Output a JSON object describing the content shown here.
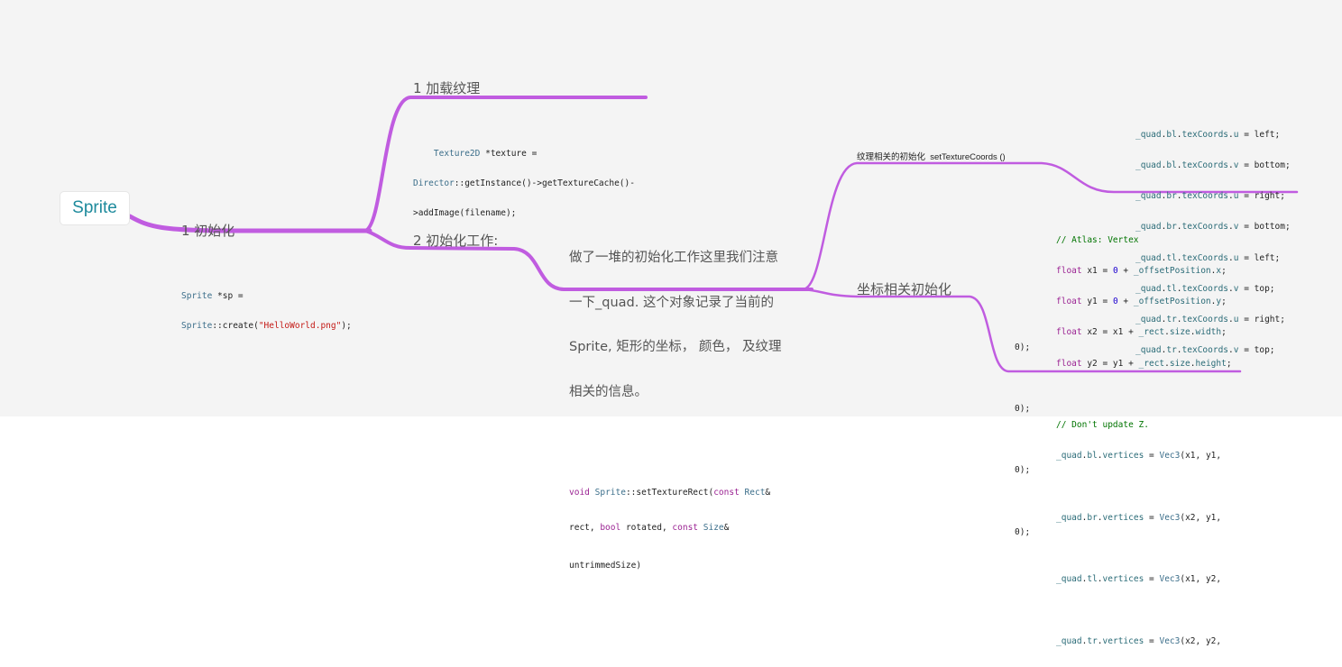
{
  "root": {
    "label": "Sprite"
  },
  "colors": {
    "branch": "#c05ce0",
    "root_text": "#1d8a9c"
  },
  "nodes": {
    "init": {
      "title": "1 初始化",
      "code": [
        "Sprite *sp =",
        "Sprite::create(\"HelloWorld.png\");"
      ]
    },
    "load_texture": {
      "title": "1 加载纹理",
      "code": [
        "Texture2D *texture =",
        "Director::getInstance()->getTextureCache()-",
        ">addImage(filename);"
      ]
    },
    "init_work": {
      "title": "2 初始化工作:"
    },
    "init_note": {
      "text": [
        "做了一堆的初始化工作这里我们注意",
        "一下_quad. 这个对象记录了当前的",
        "Sprite, 矩形的坐标， 颜色， 及纹理",
        "相关的信息。"
      ],
      "code": [
        "void Sprite::setTextureRect(const Rect&",
        "rect, bool rotated, const Size&",
        "untrimmedSize)"
      ]
    },
    "texture_init": {
      "title": "纹理相关的初始化  setTextureCoords ()"
    },
    "texture_coords": {
      "code": [
        "_quad.bl.texCoords.u = left;",
        "_quad.bl.texCoords.v = bottom;",
        "_quad.br.texCoords.u = right;",
        "_quad.br.texCoords.v = bottom;",
        "_quad.tl.texCoords.u = left;",
        "_quad.tl.texCoords.v = top;",
        "_quad.tr.texCoords.u = right;",
        "_quad.tr.texCoords.v = top;"
      ]
    },
    "coord_init": {
      "title": "坐标相关初始化"
    },
    "vertex_code": {
      "code": [
        "// Atlas: Vertex",
        "float x1 = 0 + _offsetPosition.x;",
        "float y1 = 0 + _offsetPosition.y;",
        "float x2 = x1 + _rect.size.width;",
        "float y2 = y1 + _rect.size.height;",
        "",
        "// Don't update Z.",
        "_quad.bl.vertices = Vec3(x1, y1,",
        "",
        "_quad.br.vertices = Vec3(x2, y1,",
        "",
        "_quad.tl.vertices = Vec3(x1, y2,",
        "",
        "_quad.tr.vertices = Vec3(x2, y2,"
      ],
      "tail": [
        "0);",
        "0);",
        "0);",
        "0);"
      ]
    }
  }
}
